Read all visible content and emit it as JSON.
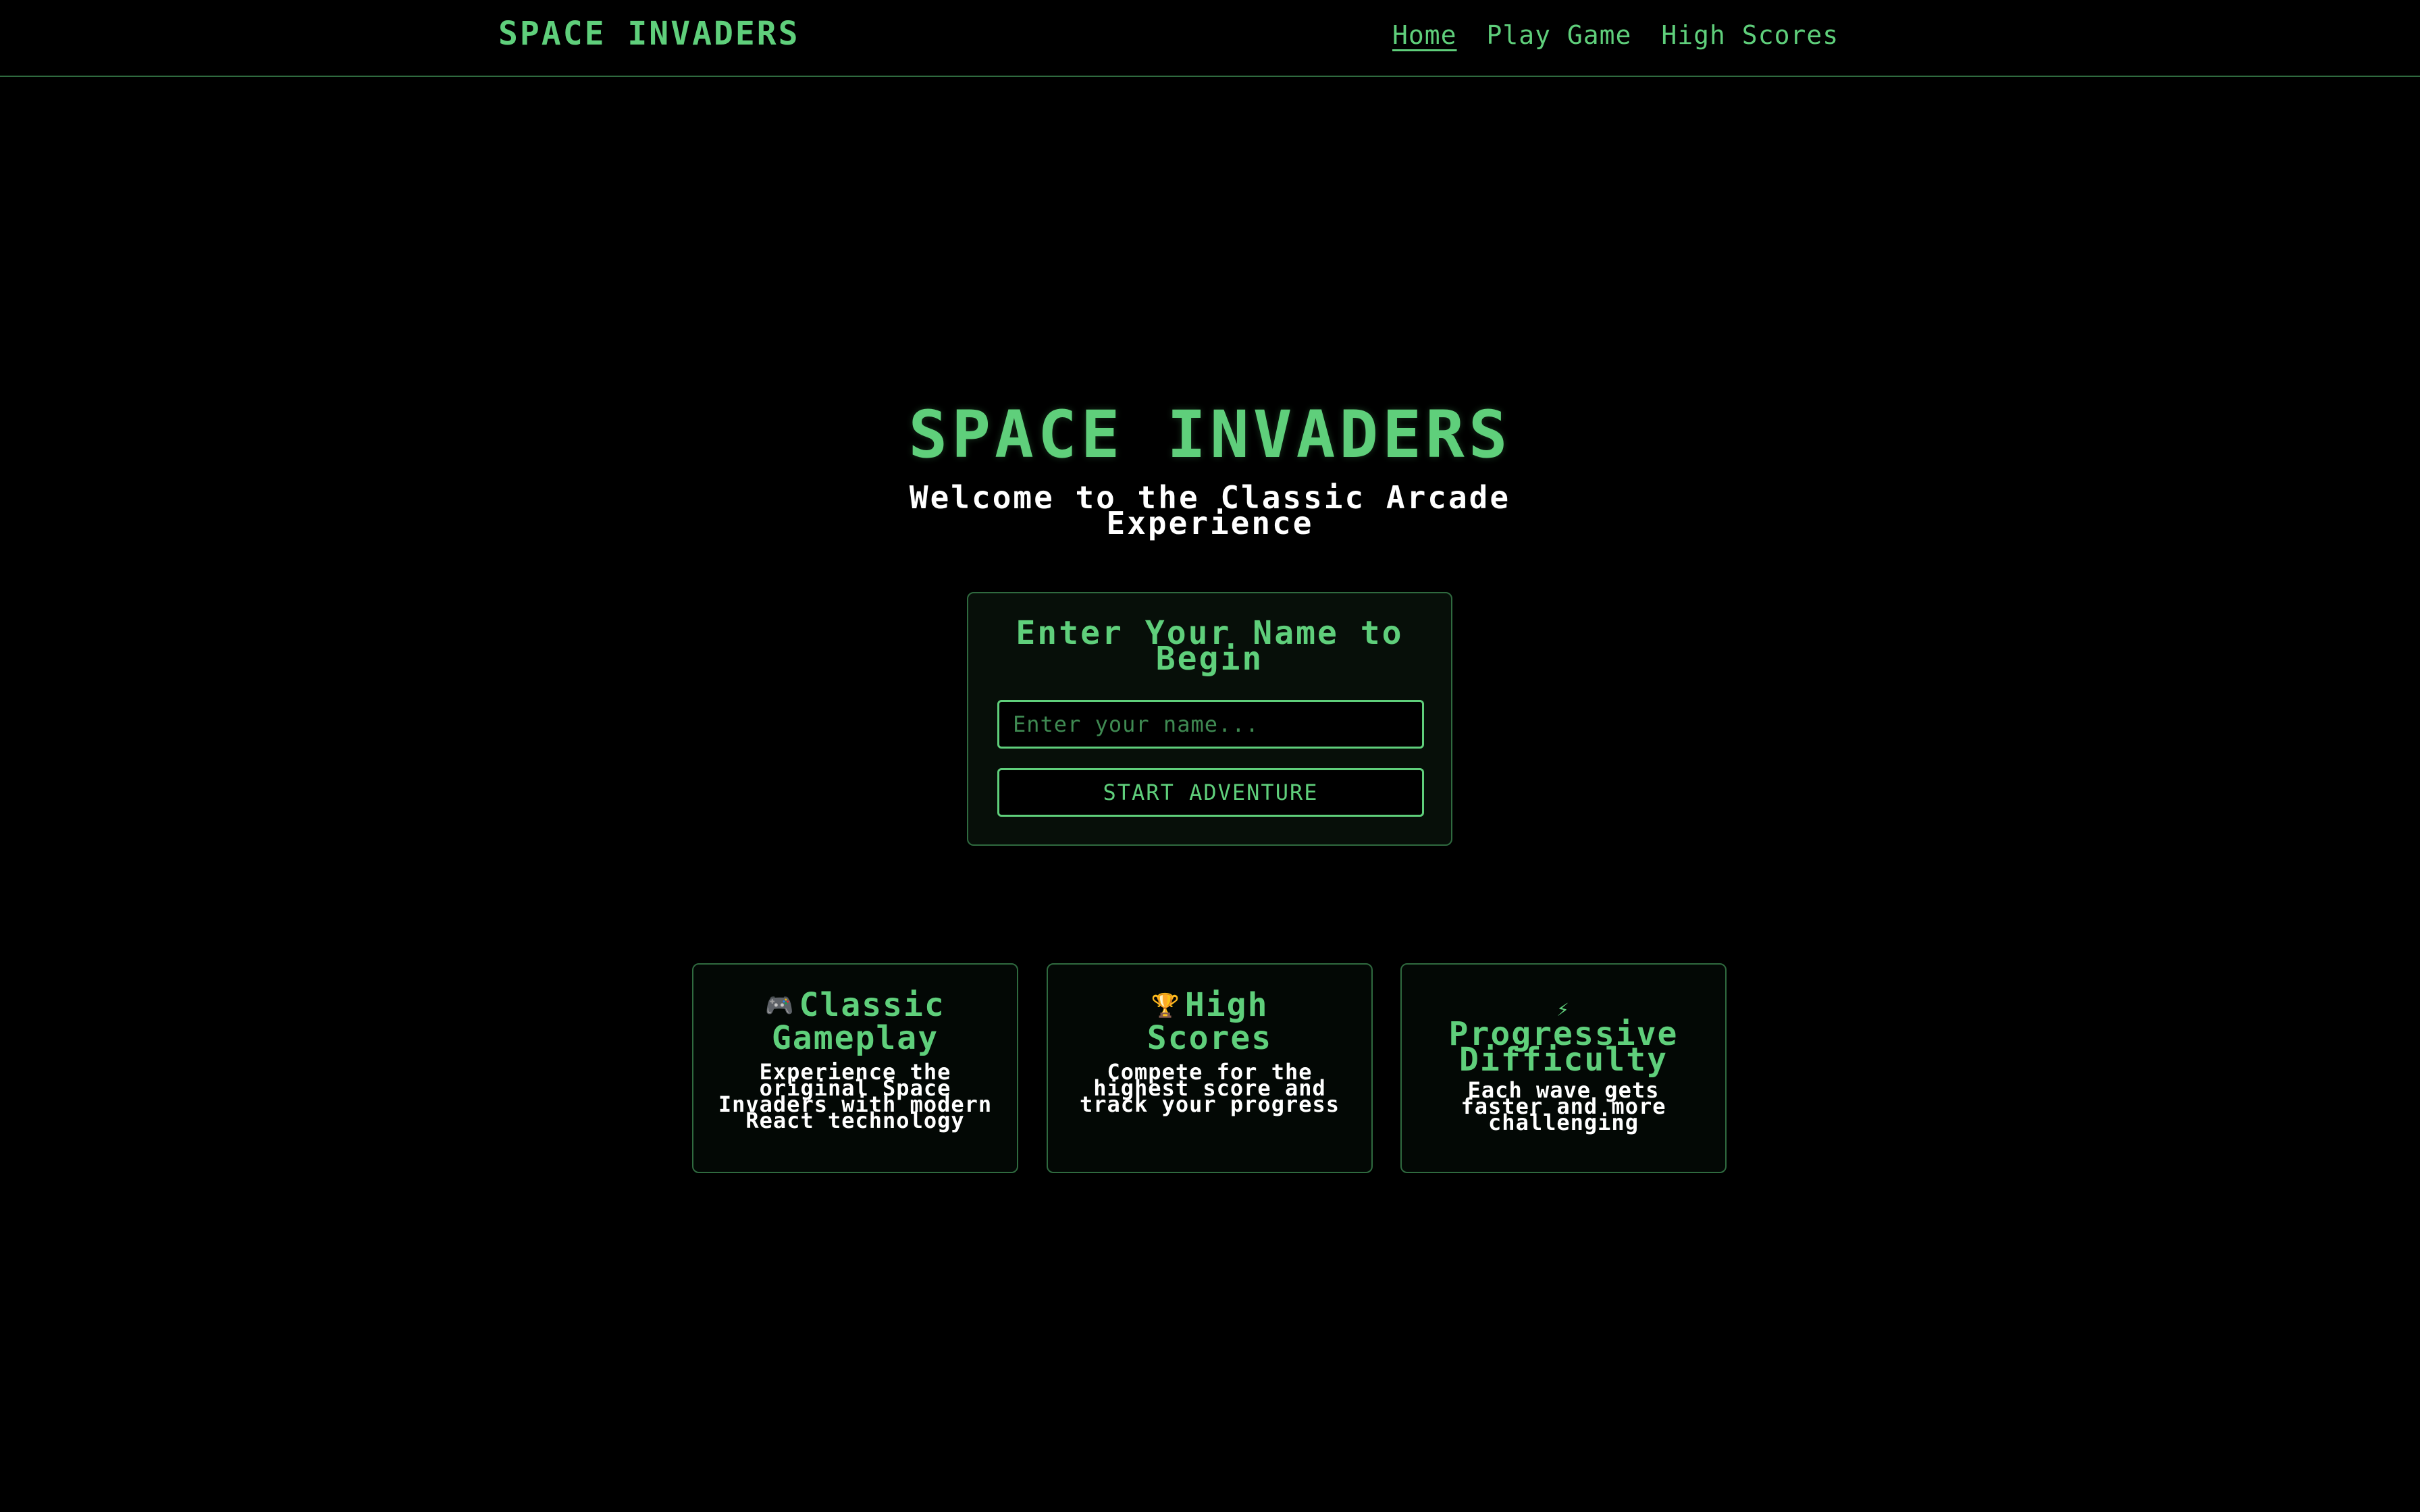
{
  "navbar": {
    "brand": "SPACE INVADERS",
    "links": [
      {
        "label": "Home",
        "active": true
      },
      {
        "label": "Play Game",
        "active": false
      },
      {
        "label": "High Scores",
        "active": false
      }
    ]
  },
  "hero": {
    "title": "SPACE INVADERS",
    "subtitle": "Welcome to the Classic Arcade Experience"
  },
  "name_panel": {
    "heading": "Enter Your Name to Begin",
    "input_placeholder": "Enter your name...",
    "input_value": "",
    "start_button_label": "START ADVENTURE"
  },
  "features": [
    {
      "icon": "gamepad-icon",
      "icon_glyph": "🎮",
      "title": "Classic Gameplay",
      "description": "Experience the original Space Invaders with modern React technology"
    },
    {
      "icon": "trophy-icon",
      "icon_glyph": "🏆",
      "title": "High Scores",
      "description": "Compete for the highest score and track your progress"
    },
    {
      "icon": "lightning-icon",
      "icon_glyph": "⚡",
      "title": "Progressive Difficulty",
      "description": "Each wave gets faster and more challenging"
    }
  ],
  "colors": {
    "accent": "#5fcf7b",
    "background": "#000000",
    "border": "#2f6a3f",
    "text": "#ffffff"
  }
}
